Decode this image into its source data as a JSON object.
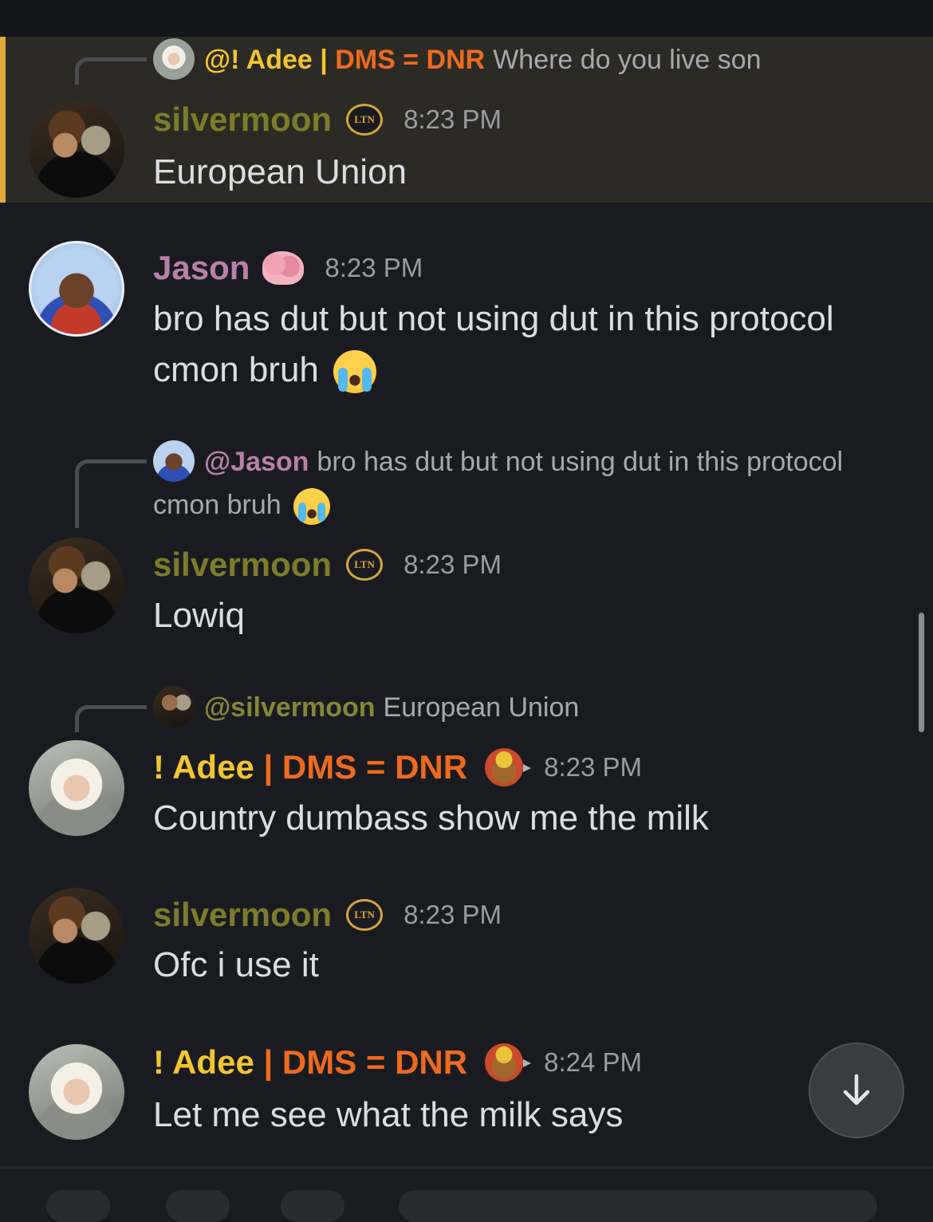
{
  "messages": [
    {
      "reply": {
        "mention": "@! Adee | DMS = DNR",
        "mention_parts": [
          "@! Adee",
          " | ",
          "DMS = DNR"
        ],
        "text": "Where do you live son"
      },
      "author": "silvermoon",
      "badge": "LTN",
      "time": "8:23 PM",
      "text": "European Union",
      "highlighted": true
    },
    {
      "author": "Jason",
      "time": "8:23 PM",
      "text": "bro has dut but not using dut in this protocol cmon bruh",
      "emoji": "loudly-crying-face"
    },
    {
      "reply": {
        "mention": "@Jason",
        "text": "bro has dut but not using dut in this protocol cmon bruh"
      },
      "author": "silvermoon",
      "badge": "LTN",
      "time": "8:23 PM",
      "text": "Lowiq"
    },
    {
      "reply": {
        "mention": "@silvermoon",
        "text": "European Union"
      },
      "author": "! Adee | DMS = DNR",
      "author_parts": [
        "! Adee",
        " | ",
        "DMS = DNR"
      ],
      "time": "8:23 PM",
      "text": "Country dumbass show me the milk"
    },
    {
      "author": "silvermoon",
      "badge": "LTN",
      "time": "8:23 PM",
      "text": "Ofc i use it"
    },
    {
      "author": "! Adee | DMS = DNR",
      "author_parts": [
        "! Adee",
        " | ",
        "DMS = DNR"
      ],
      "time": "8:24 PM",
      "text": "Let me see what the milk says"
    }
  ],
  "icons": {
    "jump": "arrow-down-icon",
    "brain": "brain-emoji",
    "cry": "loudly-crying-face-emoji",
    "character": "character-emoji"
  },
  "colors": {
    "background": "#1a1b21",
    "highlight": "#2c2a24",
    "highlight_bar": "#e1a83a",
    "silvermoon": "#7c7c2a",
    "jason": "#b880a8",
    "adee_yellow": "#f2c531",
    "adee_orange": "#ee6a1f"
  }
}
